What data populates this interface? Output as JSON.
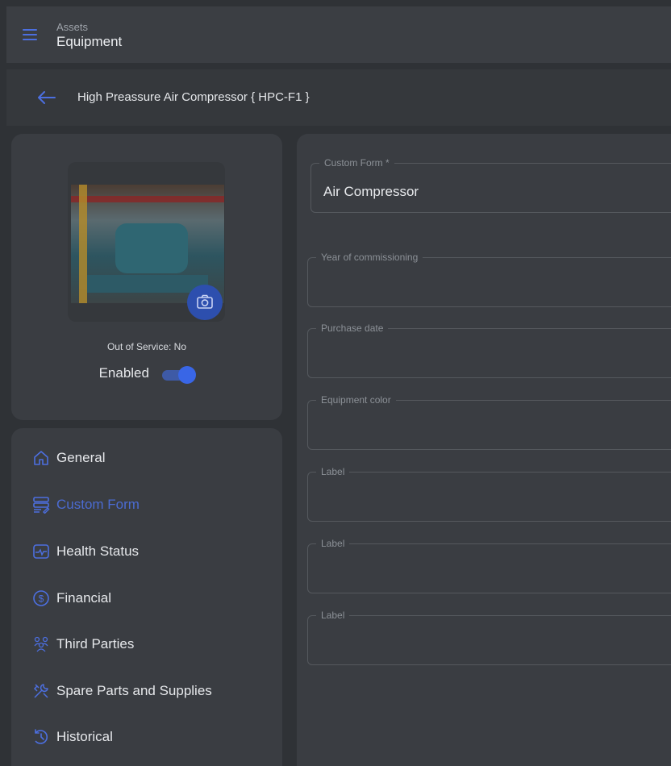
{
  "appbar": {
    "breadcrumb": "Assets",
    "title": "Equipment"
  },
  "subheader": {
    "title": "High Preassure Air Compressor { HPC-F1 }"
  },
  "equipment_card": {
    "out_of_service": "Out of Service: No",
    "enabled_label": "Enabled",
    "enabled": true
  },
  "nav": {
    "items": [
      {
        "label": "General",
        "icon": "home-icon"
      },
      {
        "label": "Custom Form",
        "icon": "form-icon",
        "active": true
      },
      {
        "label": "Health Status",
        "icon": "health-icon"
      },
      {
        "label": "Financial",
        "icon": "dollar-icon"
      },
      {
        "label": "Third Parties",
        "icon": "people-icon"
      },
      {
        "label": "Spare Parts and Supplies",
        "icon": "tools-icon"
      },
      {
        "label": "Historical",
        "icon": "history-icon"
      }
    ]
  },
  "form": {
    "fields": [
      {
        "label": "Custom Form *",
        "value": "Air Compressor"
      },
      {
        "label": "Year of commissioning",
        "value": ""
      },
      {
        "label": "Purchase date",
        "value": ""
      },
      {
        "label": "Equipment color",
        "value": ""
      },
      {
        "label": "Label",
        "value": ""
      },
      {
        "label": "Label",
        "value": ""
      },
      {
        "label": "Label",
        "value": ""
      }
    ]
  },
  "colors": {
    "accent": "#4c6fe0",
    "background": "#2f3236",
    "card": "#3a3d42"
  }
}
